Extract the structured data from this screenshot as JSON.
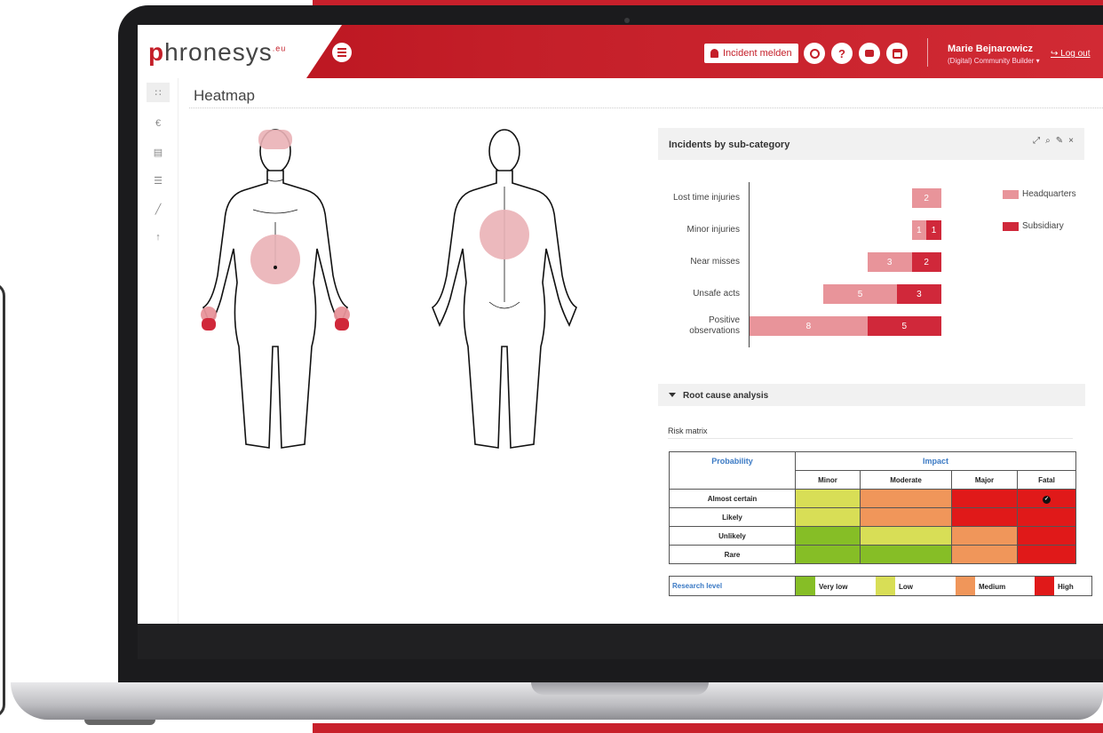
{
  "app": {
    "logo_text": "hronesys",
    "logo_letter": "p",
    "logo_suffix": ".eu"
  },
  "header": {
    "incident_button": "Incident melden",
    "help_label": "?",
    "user_name": "Marie Bejnarowicz",
    "user_role": "(Digital) Community Builder ▾",
    "logout": "↪ Log out"
  },
  "sidebar": {
    "items": [
      {
        "icon": "grid-icon",
        "glyph": "∷"
      },
      {
        "icon": "euro-icon",
        "glyph": "€"
      },
      {
        "icon": "documents-icon",
        "glyph": "▤"
      },
      {
        "icon": "list-icon",
        "glyph": "☰"
      },
      {
        "icon": "line-chart-icon",
        "glyph": "╱"
      },
      {
        "icon": "upload-icon",
        "glyph": "↑"
      }
    ]
  },
  "page": {
    "title": "Heatmap"
  },
  "chart_panel": {
    "title": "Incidents by sub-category",
    "tools": [
      "⤢",
      "⌕",
      "✎",
      "×"
    ]
  },
  "chart_data": {
    "type": "bar",
    "orientation": "horizontal",
    "stacked": true,
    "categories": [
      "Lost time injuries",
      "Minor injuries",
      "Near misses",
      "Unsafe acts",
      "Positive observations"
    ],
    "series": [
      {
        "name": "Headquarters",
        "values": [
          2,
          1,
          3,
          5,
          8
        ],
        "color": "#e8949a"
      },
      {
        "name": "Subsidiary",
        "values": [
          0,
          1,
          2,
          3,
          5
        ],
        "color": "#d0283a"
      }
    ],
    "legend": "right"
  },
  "root_cause": {
    "label": "Root cause analysis"
  },
  "risk_matrix": {
    "label": "Risk matrix",
    "probability_header": "Probability",
    "impact_header": "Impact",
    "columns": [
      "Minor",
      "Moderate",
      "Major",
      "Fatal"
    ],
    "rows": [
      {
        "label": "Almost certain",
        "cells": [
          "#d8de56",
          "#f0965a",
          "#e01919",
          "#e01919"
        ],
        "marked": 3
      },
      {
        "label": "Likely",
        "cells": [
          "#d8de56",
          "#f0965a",
          "#e01919",
          "#e01919"
        ]
      },
      {
        "label": "Unlikely",
        "cells": [
          "#86be26",
          "#d8de56",
          "#f0965a",
          "#e01919"
        ]
      },
      {
        "label": "Rare",
        "cells": [
          "#86be26",
          "#86be26",
          "#f0965a",
          "#e01919"
        ]
      }
    ],
    "research_label": "Research level",
    "levels": [
      {
        "label": "Very low",
        "color": "#86be26"
      },
      {
        "label": "Low",
        "color": "#d8de56"
      },
      {
        "label": "Medium",
        "color": "#f0965a"
      },
      {
        "label": "High",
        "color": "#e01919"
      }
    ]
  },
  "colors": {
    "brand": "#c41f29",
    "heat_light": "#eab1b6",
    "heat_dark": "#d0283a"
  }
}
